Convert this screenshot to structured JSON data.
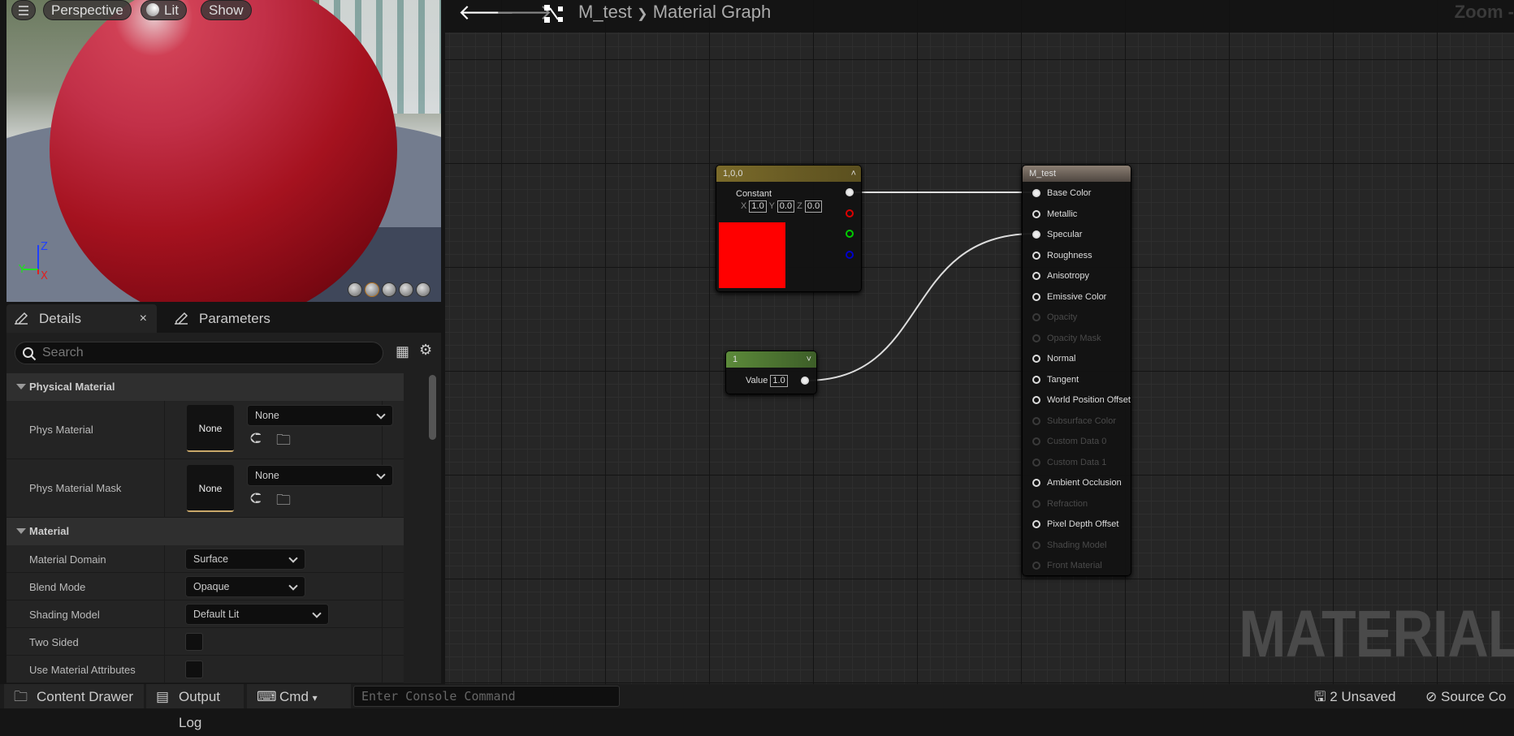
{
  "viewport": {
    "menu_icon": "hamburger-icon",
    "perspective": "Perspective",
    "lit": "Lit",
    "show": "Show",
    "axis_x": "X",
    "axis_y": "Y",
    "axis_z": "Z"
  },
  "tabs": {
    "details": "Details",
    "parameters": "Parameters",
    "close": "×"
  },
  "search": {
    "placeholder": "Search"
  },
  "sections": {
    "physical": {
      "title": "Physical Material",
      "rows": [
        {
          "label": "Phys Material",
          "thumb": "None",
          "value": "None"
        },
        {
          "label": "Phys Material Mask",
          "thumb": "None",
          "value": "None"
        }
      ]
    },
    "material": {
      "title": "Material",
      "rows": [
        {
          "label": "Material Domain",
          "value": "Surface"
        },
        {
          "label": "Blend Mode",
          "value": "Opaque"
        },
        {
          "label": "Shading Model",
          "value": "Default Lit"
        },
        {
          "label": "Two Sided",
          "checked": false
        },
        {
          "label": "Use Material Attributes",
          "checked": false
        }
      ]
    }
  },
  "graph": {
    "asset": "M_test",
    "separator": "❯",
    "title": "Material Graph",
    "zoom": "Zoom -",
    "watermark": "MATERIAL",
    "constant3": {
      "title": "1,0,0",
      "label": "Constant",
      "x": "1.0",
      "y": "0.0",
      "z": "0.0",
      "xl": "X",
      "yl": "Y",
      "zl": "Z",
      "color": "#ff0000"
    },
    "constant": {
      "title": "1",
      "label": "Value",
      "value": "1.0"
    },
    "result": {
      "title": "M_test",
      "pins": [
        {
          "name": "Base Color",
          "active": true,
          "connected": true
        },
        {
          "name": "Metallic",
          "active": true
        },
        {
          "name": "Specular",
          "active": true,
          "connected": true
        },
        {
          "name": "Roughness",
          "active": true
        },
        {
          "name": "Anisotropy",
          "active": true
        },
        {
          "name": "Emissive Color",
          "active": true
        },
        {
          "name": "Opacity",
          "active": false
        },
        {
          "name": "Opacity Mask",
          "active": false
        },
        {
          "name": "Normal",
          "active": true
        },
        {
          "name": "Tangent",
          "active": true
        },
        {
          "name": "World Position Offset",
          "active": true
        },
        {
          "name": "Subsurface Color",
          "active": false
        },
        {
          "name": "Custom Data 0",
          "active": false
        },
        {
          "name": "Custom Data 1",
          "active": false
        },
        {
          "name": "Ambient Occlusion",
          "active": true
        },
        {
          "name": "Refraction",
          "active": false
        },
        {
          "name": "Pixel Depth Offset",
          "active": true
        },
        {
          "name": "Shading Model",
          "active": false
        },
        {
          "name": "Front Material",
          "active": false
        }
      ]
    }
  },
  "bottom": {
    "content_drawer": "Content Drawer",
    "output_log": "Output Log",
    "cmd": "Cmd",
    "console_placeholder": "Enter Console Command",
    "unsaved": "2 Unsaved",
    "source_control": "Source Co"
  }
}
